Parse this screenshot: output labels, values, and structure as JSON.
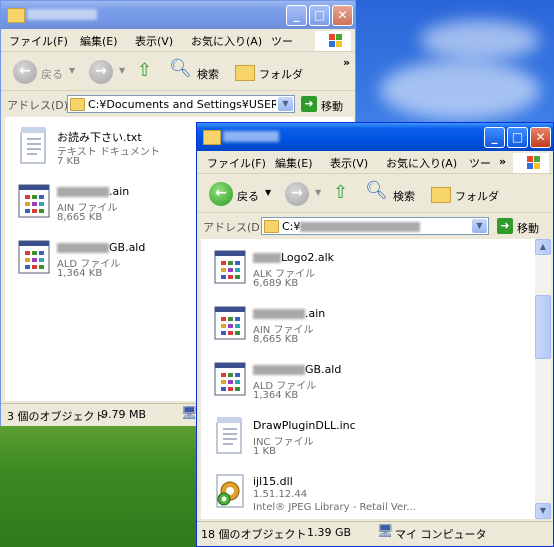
{
  "colors": {
    "titlebar_active": "#0054e3",
    "titlebar_inactive": "#7396e6",
    "window_face": "#ece9d8",
    "go_arrow": "#2e9b2a"
  },
  "menu": {
    "file": "ファイル(F)",
    "edit": "編集(E)",
    "view": "表示(V)",
    "favorites": "お気に入り(A)",
    "tools": "ツー",
    "more": "»"
  },
  "toolbar": {
    "back": "戻る",
    "search": "検索",
    "folder": "フォルダ",
    "more": "»"
  },
  "address": {
    "label": "アドレス(D)",
    "go": "移動"
  },
  "window1": {
    "address_value": "C:¥Documents and Settings¥USER¥:",
    "files": [
      {
        "name": "お読み下さい.txt",
        "type": "テキスト ドキュメント",
        "size": "7 KB",
        "icon": "text-file-icon"
      },
      {
        "name_suffix": ".ain",
        "type": "AIN ファイル",
        "size": "8,665 KB",
        "icon": "app-window-file-icon"
      },
      {
        "name_suffix": "GB.ald",
        "type": "ALD ファイル",
        "size": "1,364 KB",
        "icon": "app-window-file-icon"
      }
    ],
    "status_count": "3 個のオブジェクト",
    "status_size": "9.79 MB"
  },
  "window2": {
    "address_prefix": "C:¥",
    "files": [
      {
        "name_suffix": "Logo2.alk",
        "type": "ALK ファイル",
        "size": "6,689 KB",
        "icon": "app-window-file-icon"
      },
      {
        "name_suffix": ".ain",
        "type": "AIN ファイル",
        "size": "8,665 KB",
        "icon": "app-window-file-icon"
      },
      {
        "name_suffix": "GB.ald",
        "type": "ALD ファイル",
        "size": "1,364 KB",
        "icon": "app-window-file-icon"
      },
      {
        "name": "DrawPluginDLL.inc",
        "type": "INC ファイル",
        "size": "1 KB",
        "icon": "text-file-icon"
      },
      {
        "name": "ijl15.dll",
        "type": "1.51.12.44",
        "size": "Intel® JPEG Library - Retail Ver...",
        "icon": "dll-gear-icon"
      }
    ],
    "status_count": "18 個のオブジェクト",
    "status_size": "1.39 GB",
    "status_location": "マイ コンピュータ"
  }
}
